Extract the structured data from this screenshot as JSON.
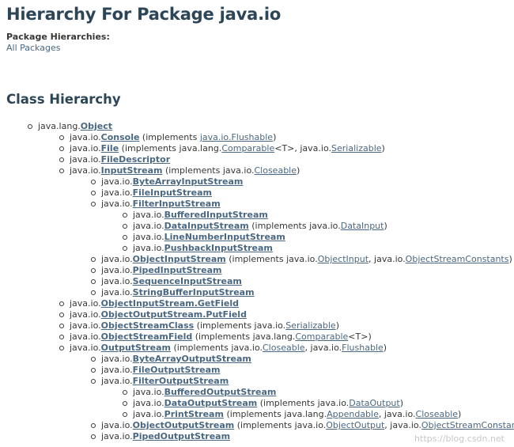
{
  "header": {
    "title": "Hierarchy For Package java.io"
  },
  "package_hierarchies": {
    "label": "Package Hierarchies:",
    "link": "All Packages"
  },
  "class_hierarchy": {
    "heading": "Class Hierarchy",
    "root": {
      "pkg": "java.lang.",
      "cls": "Object",
      "children": [
        {
          "pkg": "java.io.",
          "cls": "Console",
          "parts": [
            " (implements ",
            {
              "ref": "java.io.Flushable"
            },
            ")"
          ]
        },
        {
          "pkg": "java.io.",
          "cls": "File",
          "parts": [
            " (implements java.lang.",
            {
              "ref": "Comparable"
            },
            "<T>, java.io.",
            {
              "ref": "Serializable"
            },
            ")"
          ]
        },
        {
          "pkg": "java.io.",
          "cls": "FileDescriptor"
        },
        {
          "pkg": "java.io.",
          "cls": "InputStream",
          "parts": [
            " (implements java.io.",
            {
              "ref": "Closeable"
            },
            ")"
          ],
          "children": [
            {
              "pkg": "java.io.",
              "cls": "ByteArrayInputStream"
            },
            {
              "pkg": "java.io.",
              "cls": "FileInputStream"
            },
            {
              "pkg": "java.io.",
              "cls": "FilterInputStream",
              "children": [
                {
                  "pkg": "java.io.",
                  "cls": "BufferedInputStream"
                },
                {
                  "pkg": "java.io.",
                  "cls": "DataInputStream",
                  "parts": [
                    " (implements java.io.",
                    {
                      "ref": "DataInput"
                    },
                    ")"
                  ]
                },
                {
                  "pkg": "java.io.",
                  "cls": "LineNumberInputStream"
                },
                {
                  "pkg": "java.io.",
                  "cls": "PushbackInputStream"
                }
              ]
            },
            {
              "pkg": "java.io.",
              "cls": "ObjectInputStream",
              "parts": [
                " (implements java.io.",
                {
                  "ref": "ObjectInput"
                },
                ", java.io.",
                {
                  "ref": "ObjectStreamConstants"
                },
                ")"
              ]
            },
            {
              "pkg": "java.io.",
              "cls": "PipedInputStream"
            },
            {
              "pkg": "java.io.",
              "cls": "SequenceInputStream"
            },
            {
              "pkg": "java.io.",
              "cls": "StringBufferInputStream"
            }
          ]
        },
        {
          "pkg": "java.io.",
          "cls": "ObjectInputStream.GetField"
        },
        {
          "pkg": "java.io.",
          "cls": "ObjectOutputStream.PutField"
        },
        {
          "pkg": "java.io.",
          "cls": "ObjectStreamClass",
          "parts": [
            " (implements java.io.",
            {
              "ref": "Serializable"
            },
            ")"
          ]
        },
        {
          "pkg": "java.io.",
          "cls": "ObjectStreamField",
          "parts": [
            " (implements java.lang.",
            {
              "ref": "Comparable"
            },
            "<T>)"
          ]
        },
        {
          "pkg": "java.io.",
          "cls": "OutputStream",
          "parts": [
            " (implements java.io.",
            {
              "ref": "Closeable"
            },
            ", java.io.",
            {
              "ref": "Flushable"
            },
            ")"
          ],
          "children": [
            {
              "pkg": "java.io.",
              "cls": "ByteArrayOutputStream"
            },
            {
              "pkg": "java.io.",
              "cls": "FileOutputStream"
            },
            {
              "pkg": "java.io.",
              "cls": "FilterOutputStream",
              "children": [
                {
                  "pkg": "java.io.",
                  "cls": "BufferedOutputStream"
                },
                {
                  "pkg": "java.io.",
                  "cls": "DataOutputStream",
                  "parts": [
                    " (implements java.io.",
                    {
                      "ref": "DataOutput"
                    },
                    ")"
                  ]
                },
                {
                  "pkg": "java.io.",
                  "cls": "PrintStream",
                  "parts": [
                    " (implements java.lang.",
                    {
                      "ref": "Appendable"
                    },
                    ", java.io.",
                    {
                      "ref": "Closeable"
                    },
                    ")"
                  ]
                }
              ]
            },
            {
              "pkg": "java.io.",
              "cls": "ObjectOutputStream",
              "parts": [
                " (implements java.io.",
                {
                  "ref": "ObjectOutput"
                },
                ", java.io.",
                {
                  "ref": "ObjectStreamConstants"
                },
                ")"
              ]
            },
            {
              "pkg": "java.io.",
              "cls": "PipedOutputStream"
            }
          ]
        }
      ]
    }
  },
  "watermark": "https://blog.csdn.net",
  "colors": {
    "heading": "#2c4557",
    "link": "#4a6782",
    "text": "#353833"
  }
}
